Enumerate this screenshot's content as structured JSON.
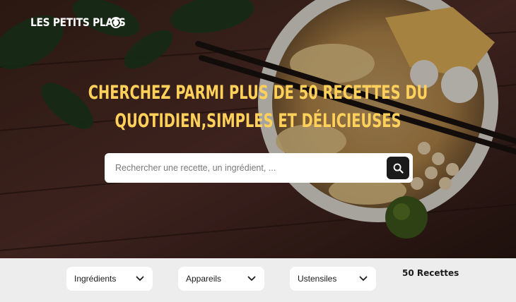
{
  "header": {
    "logo_text": "LES PETITS PLATS"
  },
  "hero": {
    "headline_line1": "CHERCHEZ PARMI PLUS DE 50 RECETTES DU",
    "headline_line2": "QUOTIDIEN,SIMPLES ET DÉLICIEUSES"
  },
  "search": {
    "placeholder": "Rechercher une recette, un ingrédient, ...",
    "value": "",
    "button_icon": "search-icon"
  },
  "filters": {
    "ingredients_label": "Ingrédients",
    "appliances_label": "Appareils",
    "utensils_label": "Ustensiles",
    "recipe_count": "50 Recettes"
  },
  "colors": {
    "accent_yellow": "#ffd15b",
    "dark": "#1b1b1b",
    "filter_bar_bg": "#ededed"
  }
}
